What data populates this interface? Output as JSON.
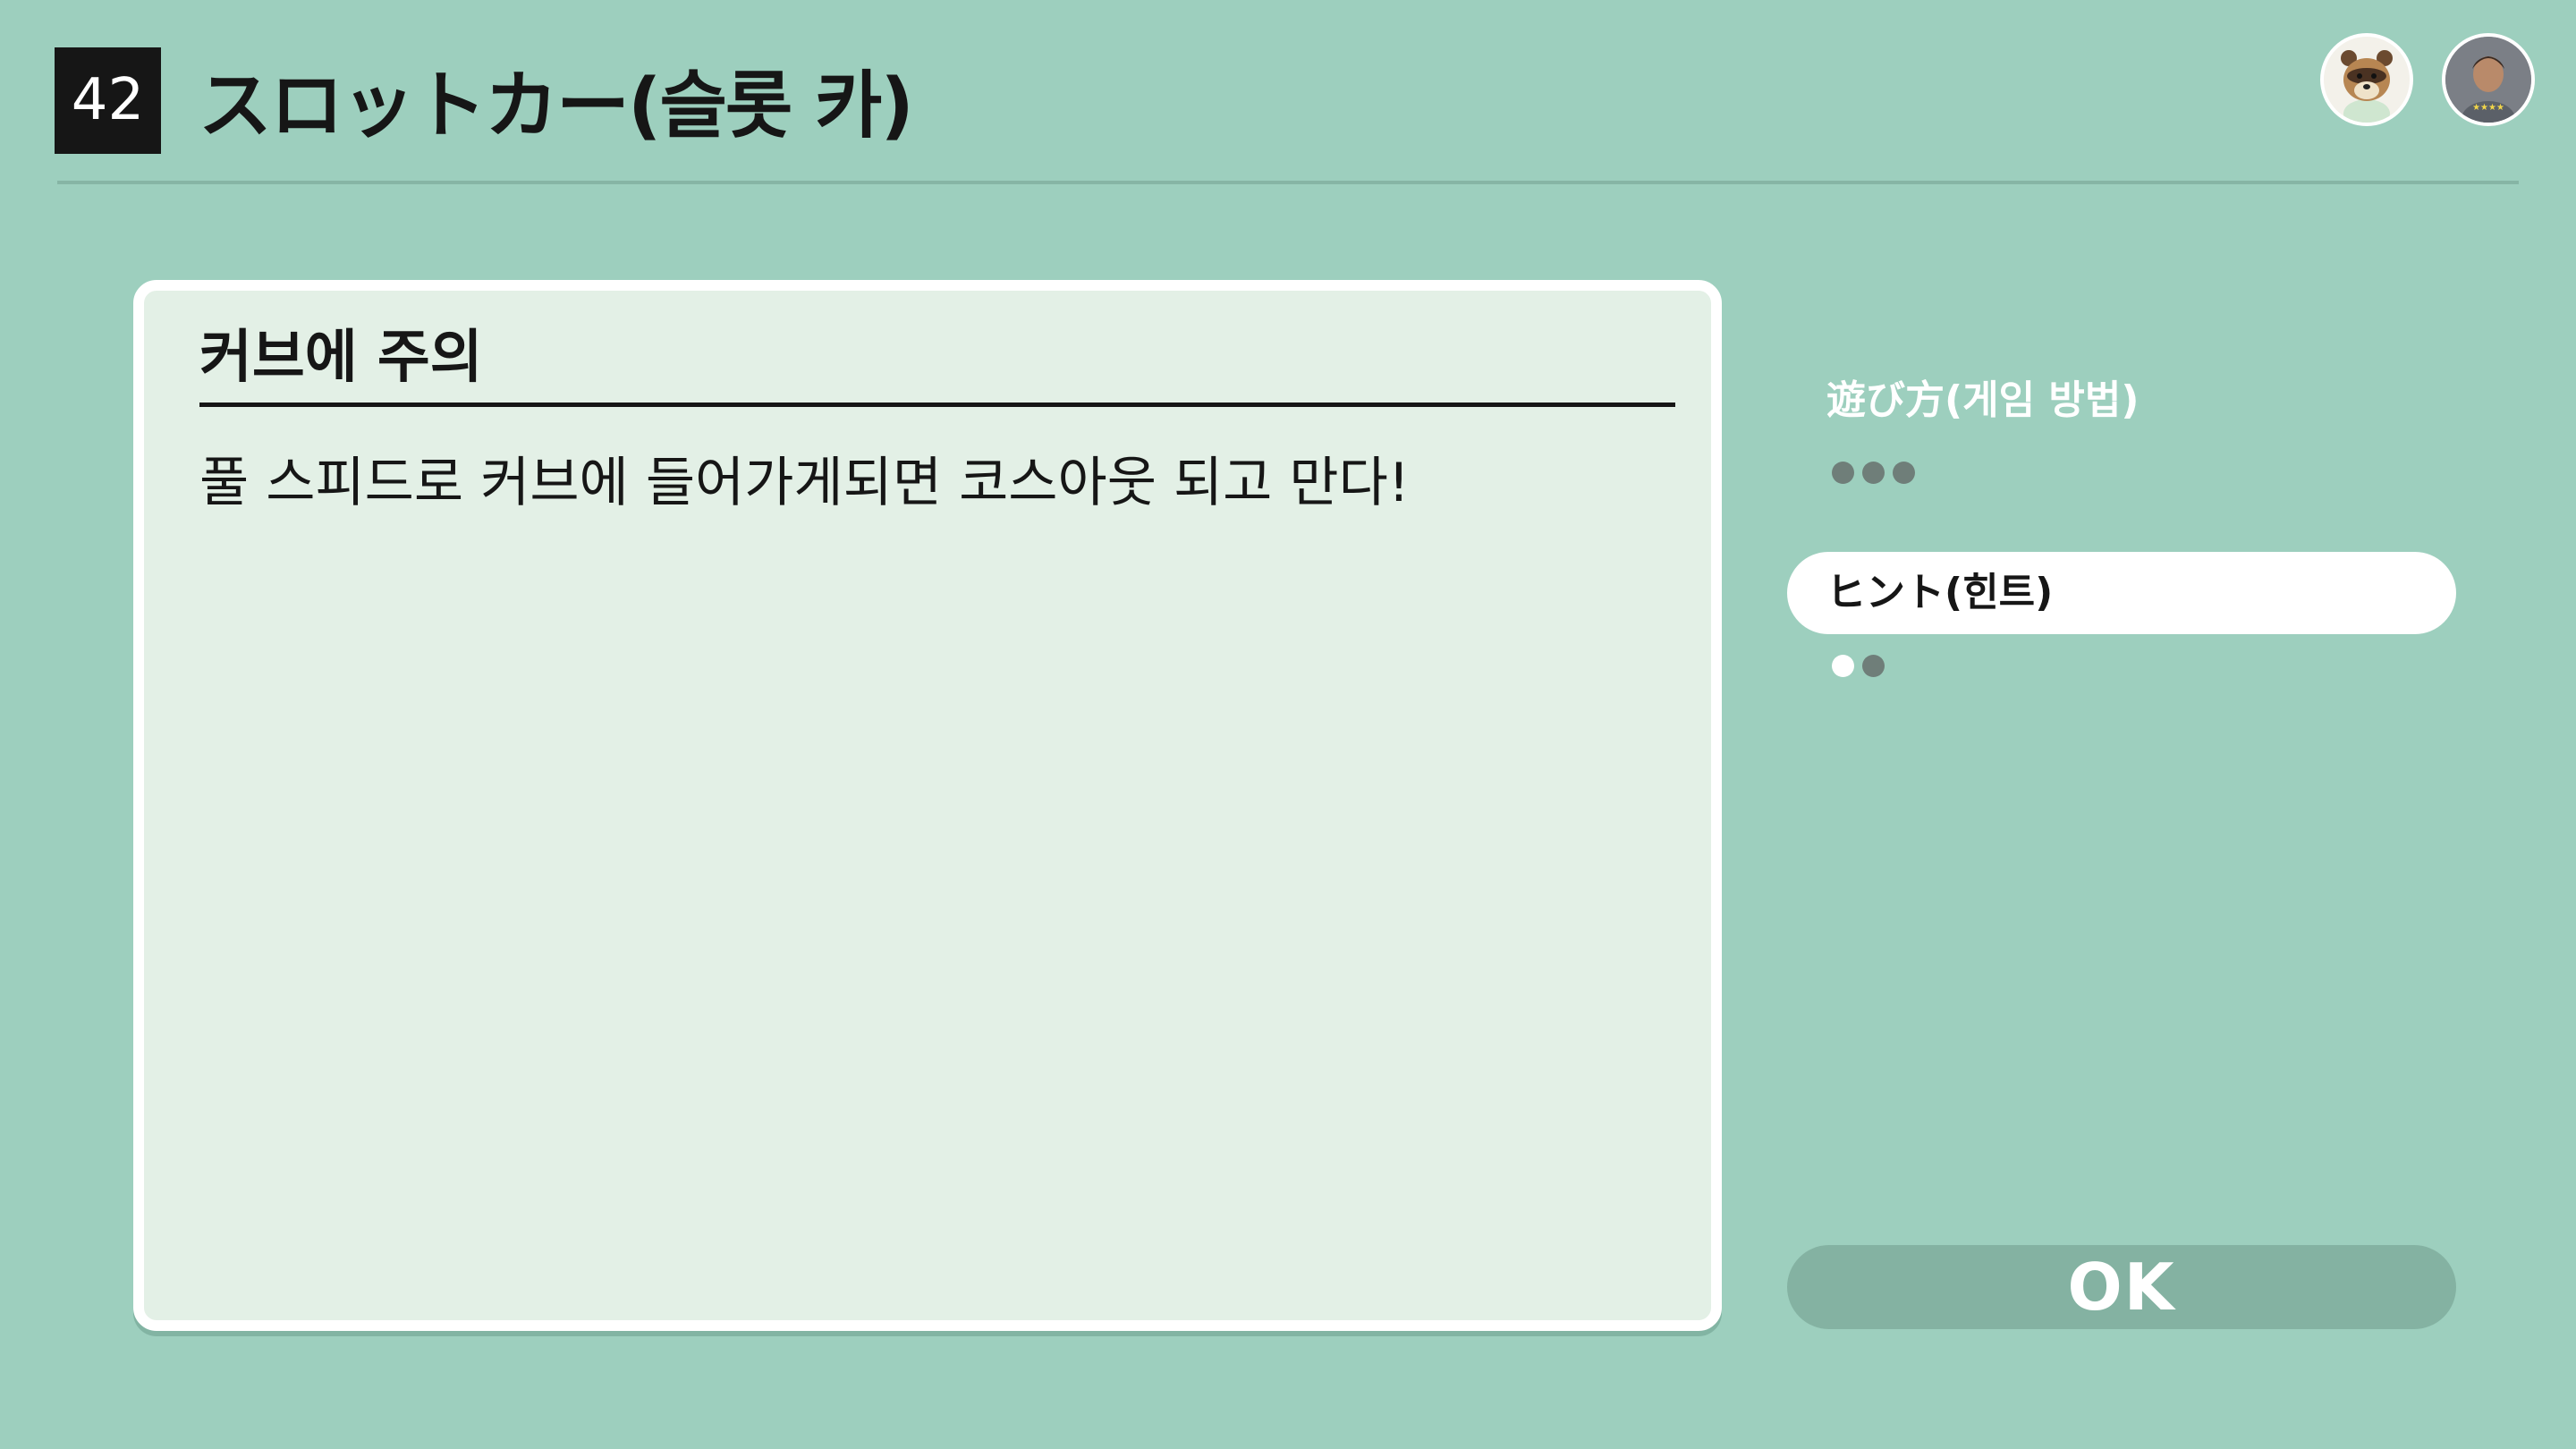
{
  "header": {
    "game_number": "42",
    "title": "スロットカー(슬롯 카)"
  },
  "avatars": [
    {
      "icon": "tom-nook-avatar-icon"
    },
    {
      "icon": "villager-avatar-icon"
    }
  ],
  "card": {
    "heading": "커브에 주의",
    "body": "풀 스피드로 커브에 들어가게되면 코스아웃 되고 만다!"
  },
  "side_menu": {
    "how_to_play": {
      "label": "遊び方(게임 방법)",
      "dots_total": 3,
      "dots_active": 0
    },
    "hints": {
      "label": "ヒント(힌트)",
      "dots_total": 2,
      "dots_active": 1
    }
  },
  "ok_button": {
    "label": "OK"
  },
  "colors": {
    "background": "#9dcfbe",
    "card": "#e3f0e6",
    "ok_button": "#84b2a2",
    "dot_inactive": "#6f7e79"
  }
}
